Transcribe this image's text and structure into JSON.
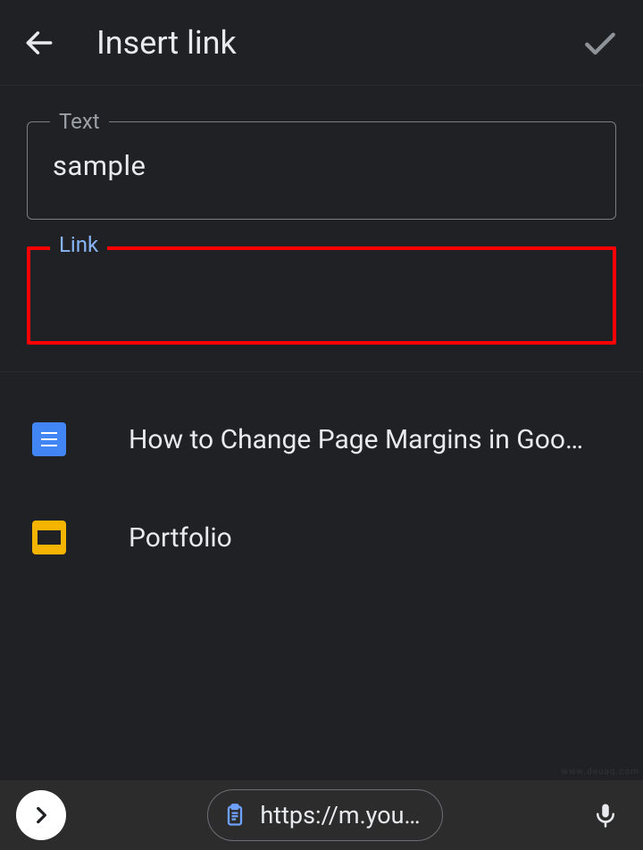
{
  "header": {
    "title": "Insert link"
  },
  "fields": {
    "text": {
      "label": "Text",
      "value": "sample"
    },
    "link": {
      "label": "Link",
      "value": ""
    }
  },
  "suggestions": [
    {
      "icon": "docs-icon",
      "label": "How to Change Page Margins in Goo…"
    },
    {
      "icon": "slides-icon",
      "label": "Portfolio"
    }
  ],
  "bottom": {
    "clipboard": "https://m.you…"
  },
  "watermark": "www.deuaq.com"
}
